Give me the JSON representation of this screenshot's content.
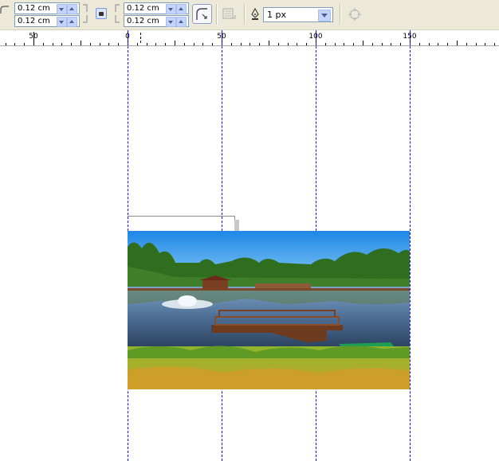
{
  "toolbar": {
    "corner_radius": {
      "top_left": "0.12 cm",
      "bottom_left": "0.12 cm",
      "top_right": "0.12 cm",
      "bottom_right": "0.12 cm"
    },
    "outline_width": "1 px"
  },
  "ruler": {
    "labels": [
      "50",
      "0",
      "50",
      "100",
      "150"
    ]
  },
  "colors": {
    "toolbar_bg": "#ece9d8",
    "guide": "#1a1ab5"
  },
  "canvas": {
    "image_description_icon": "lake-pavilion-photo"
  }
}
